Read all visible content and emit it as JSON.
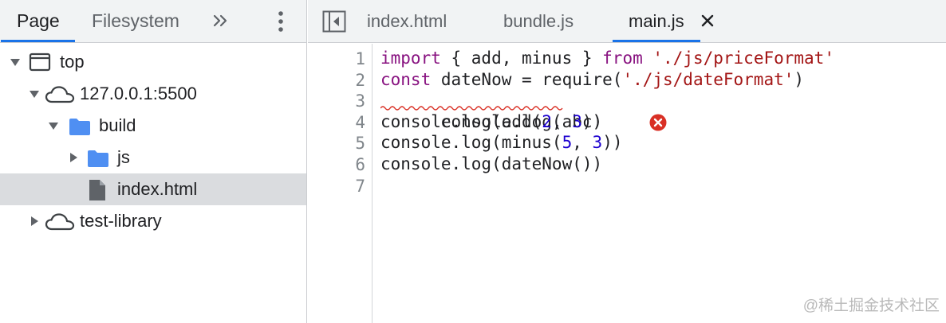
{
  "navigator": {
    "tabs": [
      "Page",
      "Filesystem"
    ],
    "active_tab": "Page",
    "more_tabs_icon": "chevron-double-right-icon",
    "menu_icon": "kebab-menu-icon",
    "tree": [
      {
        "label": "top",
        "icon": "frame-icon",
        "expanded": true
      },
      {
        "label": "127.0.0.1:5500",
        "icon": "cloud-icon",
        "expanded": true
      },
      {
        "label": "build",
        "icon": "folder-icon",
        "expanded": true
      },
      {
        "label": "js",
        "icon": "folder-icon",
        "expanded": false
      },
      {
        "label": "index.html",
        "icon": "file-icon",
        "selected": true
      },
      {
        "label": "test-library",
        "icon": "cloud-icon",
        "expanded": false
      }
    ]
  },
  "editor": {
    "toggle_icon": "toggle-navigator-icon",
    "tabs": [
      {
        "label": "index.html"
      },
      {
        "label": "bundle.js"
      },
      {
        "label": "main.js",
        "active": true,
        "closable": true
      }
    ],
    "line_numbers": [
      "1",
      "2",
      "3",
      "4",
      "5",
      "6",
      "7"
    ],
    "code": {
      "l1": {
        "kw1": "import",
        "mid": " { add, minus } ",
        "kw2": "from",
        "sp": " ",
        "str": "'./js/priceFormat'"
      },
      "l2": {
        "kw": "const",
        "mid": " dateNow = require(",
        "str": "'./js/dateFormat'",
        "end": ")"
      },
      "l3": {
        "text": "console.log(abc)"
      },
      "l4": {
        "pre": "console.log(add(",
        "n1": "2",
        "sep": ", ",
        "n2": "3",
        "end": "))"
      },
      "l5": {
        "pre": "console.log(minus(",
        "n1": "5",
        "sep": ", ",
        "n2": "3",
        "end": "))"
      },
      "l6": {
        "text": "console.log(dateNow())"
      }
    },
    "error_icon": "error-icon"
  },
  "watermark": "@稀土掘金技术社区",
  "colors": {
    "accent": "#1a73e8",
    "keyword": "#881280",
    "string": "#a31515",
    "number": "#1c00cf",
    "error": "#d93025",
    "folder": "#4f8ff2"
  }
}
